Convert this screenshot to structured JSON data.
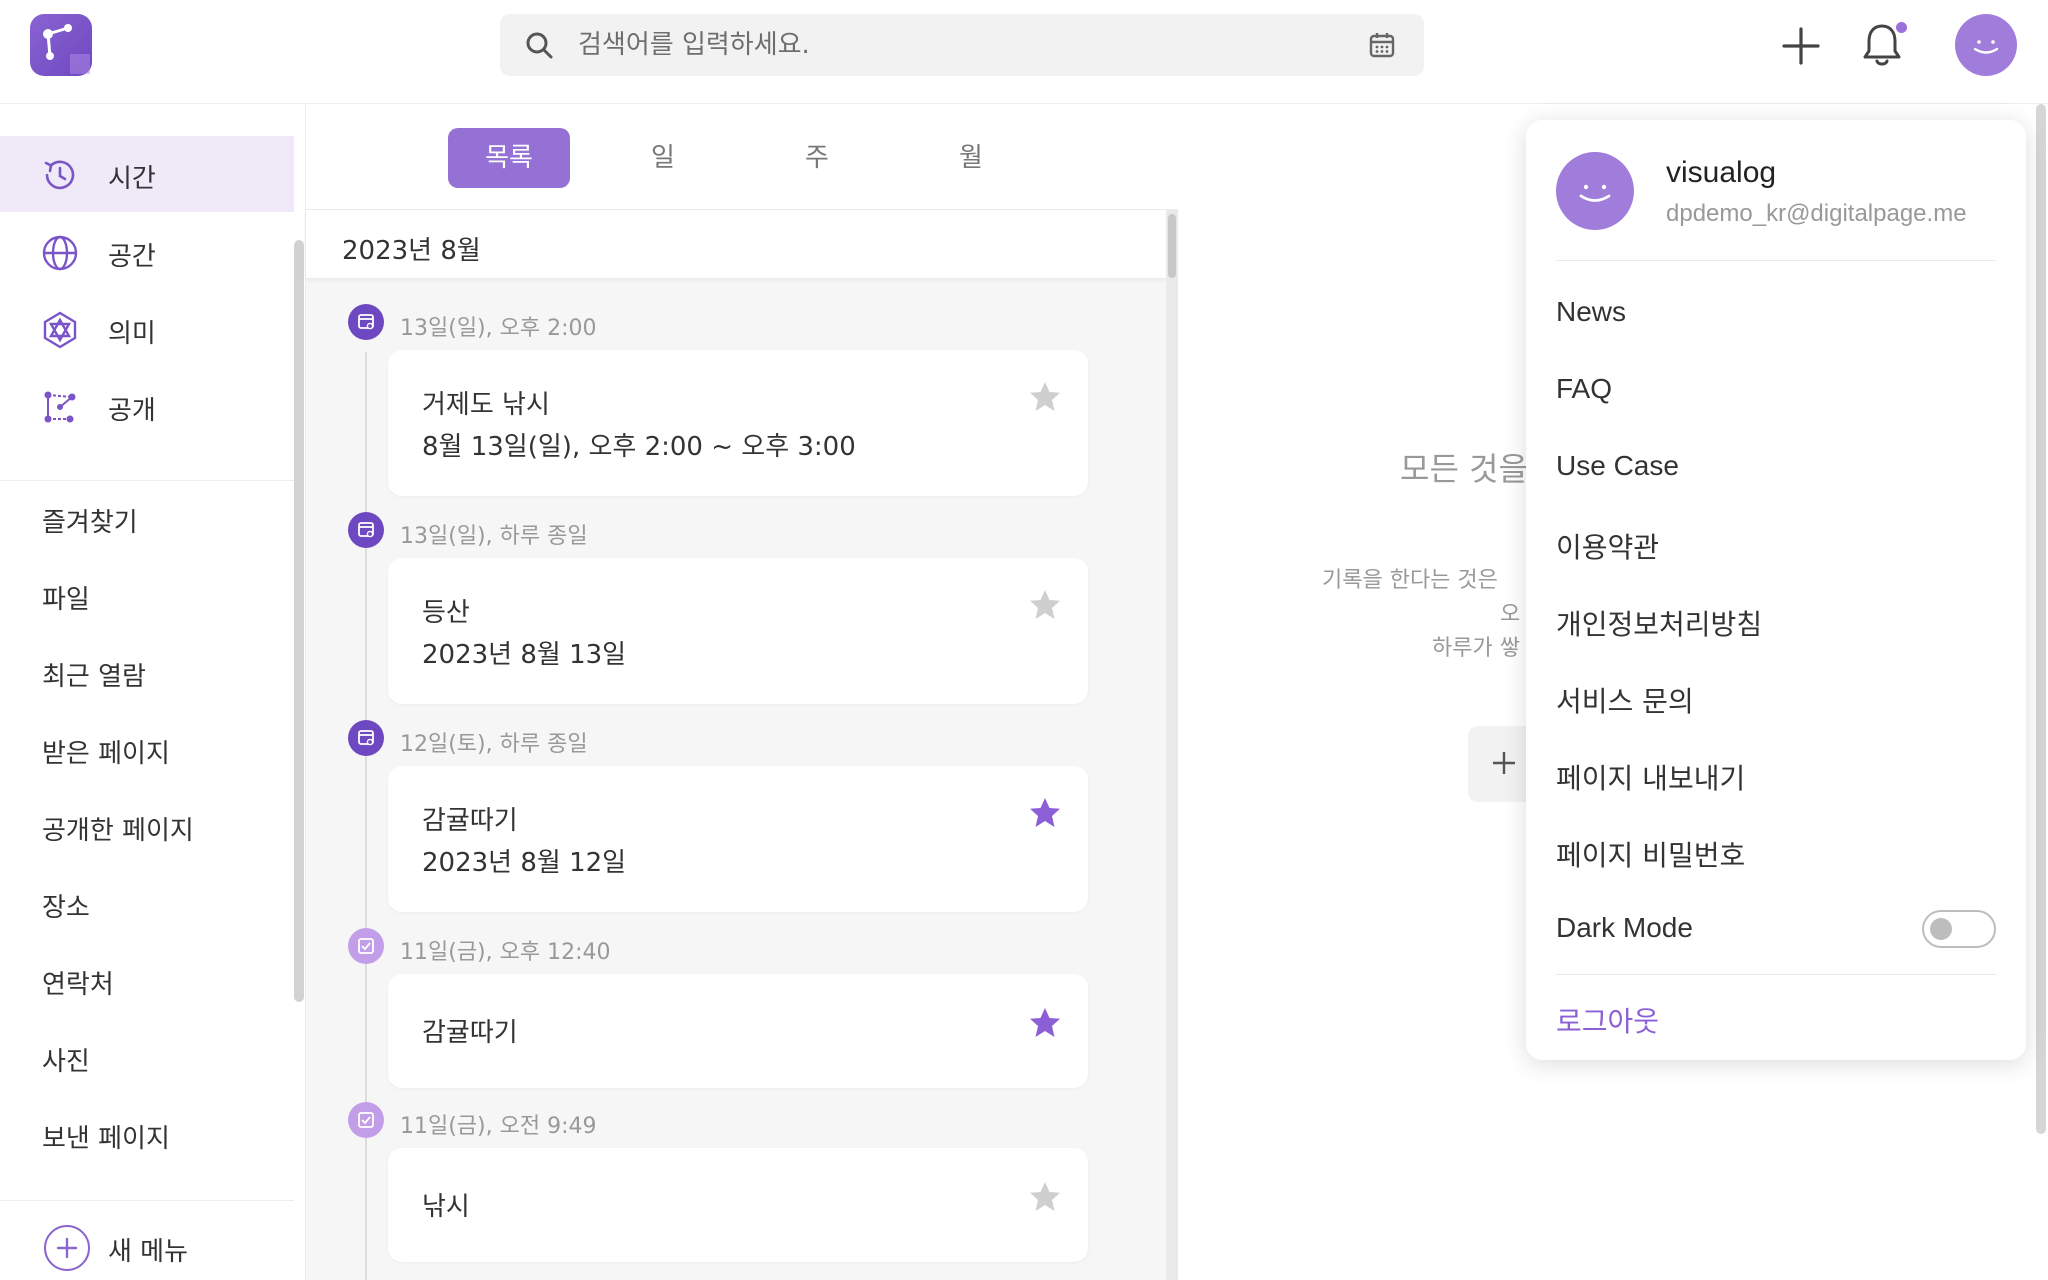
{
  "header": {
    "search_placeholder": "검색어를 입력하세요."
  },
  "sidebar": {
    "nav": [
      {
        "label": "시간",
        "icon": "clock-history-icon",
        "active": true
      },
      {
        "label": "공간",
        "icon": "globe-icon",
        "active": false
      },
      {
        "label": "의미",
        "icon": "network-icon",
        "active": false
      },
      {
        "label": "공개",
        "icon": "share-graph-icon",
        "active": false
      }
    ],
    "menu": [
      "즐겨찾기",
      "파일",
      "최근 열람",
      "받은 페이지",
      "공개한 페이지",
      "장소",
      "연락처",
      "사진",
      "보낸 페이지"
    ],
    "new_menu_label": "새 메뉴"
  },
  "list": {
    "tabs": [
      "목록",
      "일",
      "주",
      "월"
    ],
    "active_tab": "목록",
    "month": "2023년 8월",
    "entries": [
      {
        "when": "13일(일), 오후 2:00",
        "kind": "calendar",
        "title": "거제도 낚시",
        "sub": "8월 13일(일), 오후 2:00 ~ 오후 3:00",
        "starred": false
      },
      {
        "when": "13일(일), 하루 종일",
        "kind": "calendar",
        "title": "등산",
        "sub": "2023년 8월 13일",
        "starred": false
      },
      {
        "when": "12일(토), 하루 종일",
        "kind": "calendar",
        "title": "감귤따기",
        "sub": "2023년 8월 12일",
        "starred": true
      },
      {
        "when": "11일(금), 오후 12:40",
        "kind": "task",
        "title": "감귤따기",
        "sub": "",
        "starred": true
      },
      {
        "when": "11일(금), 오전 9:49",
        "kind": "task",
        "title": "낚시",
        "sub": "",
        "starred": false
      }
    ]
  },
  "content": {
    "headline": "모든 것을",
    "desc_lines": [
      "기록을 한다는 것은",
      "오",
      "하루가 쌓"
    ]
  },
  "profile_menu": {
    "name": "visualog",
    "email": "dpdemo_kr@digitalpage.me",
    "items": [
      "News",
      "FAQ",
      "Use Case",
      "이용약관",
      "개인정보처리방침",
      "서비스 문의",
      "페이지 내보내기",
      "페이지 비밀번호"
    ],
    "dark_mode_label": "Dark Mode",
    "dark_mode_on": false,
    "logout_label": "로그아웃"
  },
  "colors": {
    "accent": "#9571d6",
    "accent_dark": "#6e48c0",
    "star_on": "#8c5fd6",
    "star_off": "#cfcfcf"
  }
}
